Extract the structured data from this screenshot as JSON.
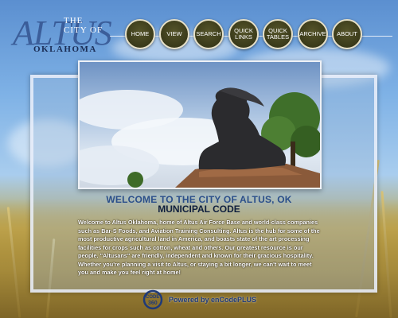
{
  "logo": {
    "city_text": "THE CITY OF",
    "main_text": "ALTUS",
    "state_text": "OKLAHOMA"
  },
  "nav": [
    {
      "label": "HOME"
    },
    {
      "label": "VIEW"
    },
    {
      "label": "SEARCH"
    },
    {
      "label": "QUICK LINKS"
    },
    {
      "label": "QUICK TABLES"
    },
    {
      "label": "ARCHIVE"
    },
    {
      "label": "ABOUT"
    }
  ],
  "main": {
    "welcome_title": "WELCOME TO THE CITY OF ALTUS, OK",
    "subtitle": "MUNICIPAL CODE",
    "intro": "Welcome to Altus Oklahoma, home of Altus Air Force Base and world-class companies such as Bar-S Foods, and Aviation Training Consulting.  Altus is the hub for some of the most productive agricultural land in America, and boasts state of the art processing facilities for crops such as cotton, wheat and others. Our greatest resource is our people. \"Altusans\" are friendly, independent and known for their gracious hospitality.  Whether you're planning a visit to Altus, or staying a bit longer, we can't wait to meet you and make you feel right at home!"
  },
  "footer": {
    "logo_text": "Code 360",
    "powered_text": "Powered by enCodePLUS"
  },
  "colors": {
    "nav_button": "#3a3a1a",
    "title_blue": "#2b4f8a",
    "subtitle": "#0f1f3d"
  }
}
